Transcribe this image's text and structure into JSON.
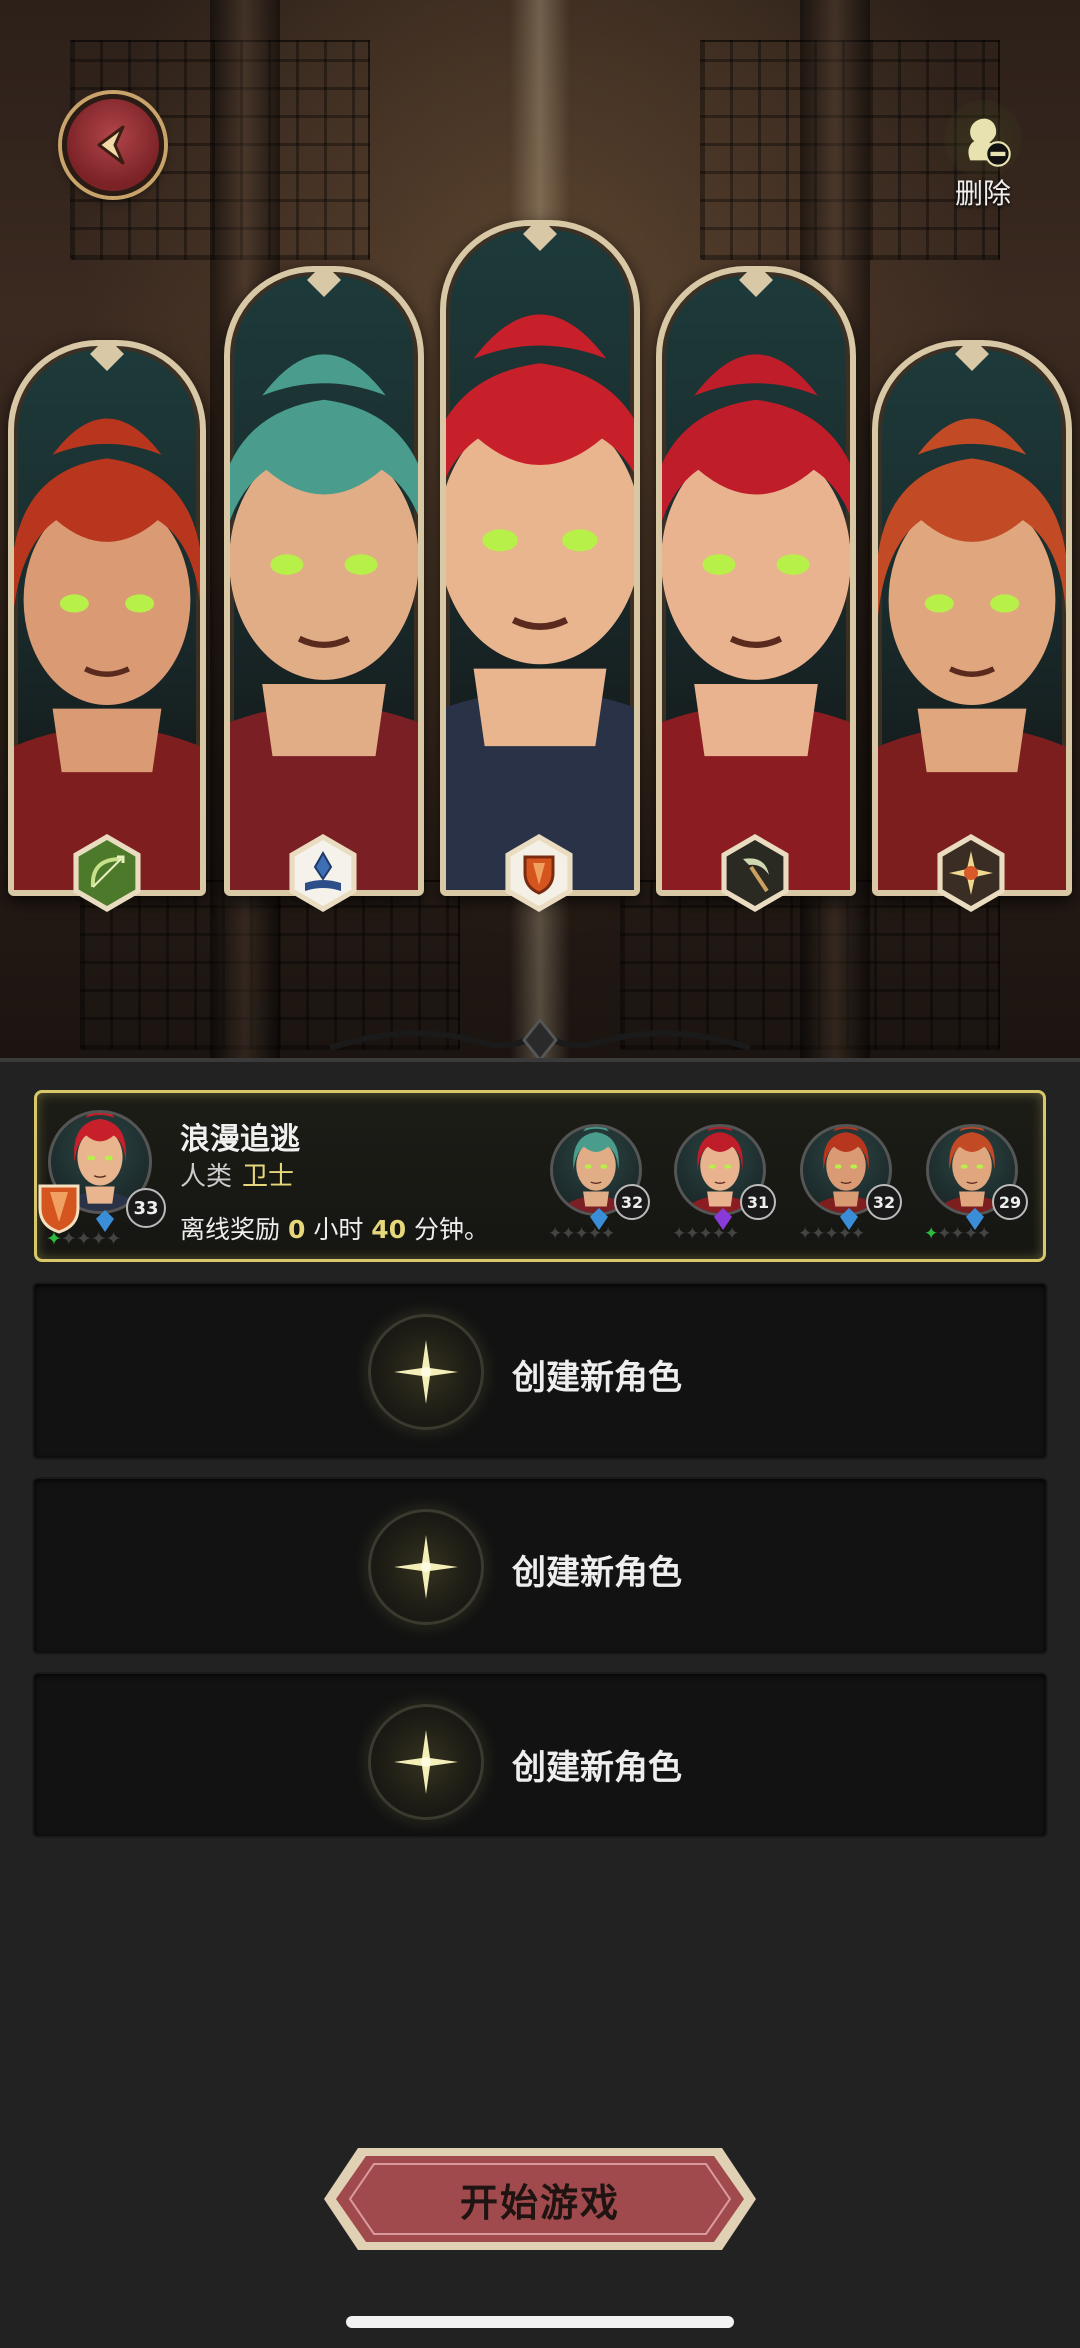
{
  "top": {
    "back_icon": "back-arrow-icon",
    "delete_label": "删除",
    "delete_icon": "delete-character-icon"
  },
  "roster": [
    {
      "id": "archer",
      "hair": "#b8361e",
      "skin": "#d99a74",
      "outfit": "#7e1e1e",
      "class_icon": "bow-icon",
      "class_color": "#4c7a2a"
    },
    {
      "id": "mage",
      "hair": "#4a9c8c",
      "skin": "#e0ad86",
      "outfit": "#7a1f24",
      "class_icon": "crystal-book-icon",
      "class_color": "#3e6fb5"
    },
    {
      "id": "guardian",
      "hair": "#c8202a",
      "skin": "#e8b58e",
      "outfit": "#2a3248",
      "class_icon": "shield-icon",
      "class_color": "#d4561e"
    },
    {
      "id": "rogue",
      "hair": "#c01d2a",
      "skin": "#e9b38f",
      "outfit": "#8a1c22",
      "class_icon": "sickle-icon",
      "class_color": "#a8b28a"
    },
    {
      "id": "priest",
      "hair": "#c24a24",
      "skin": "#e0a67e",
      "outfit": "#7c1e1e",
      "class_icon": "sun-emblem-icon",
      "class_color": "#e6c060"
    }
  ],
  "save_slot": {
    "name": "浪漫追逃",
    "race": "人类",
    "class": "卫士",
    "offline_prefix": "离线奖励",
    "hours": "0",
    "hours_unit": "小时",
    "minutes": "40",
    "minutes_unit": "分钟。",
    "main_level": "33",
    "team_levels": [
      "32",
      "31",
      "32",
      "29"
    ]
  },
  "empty_slots": [
    {
      "label": "创建新角色"
    },
    {
      "label": "创建新角色"
    },
    {
      "label": "创建新角色"
    }
  ],
  "start_button": {
    "label": "开始游戏"
  },
  "colors": {
    "accent_gold": "#e6d77a",
    "slot_border": "#d8c86a",
    "start_button": "#a04a4e",
    "star_active": "#2dbb3e"
  }
}
